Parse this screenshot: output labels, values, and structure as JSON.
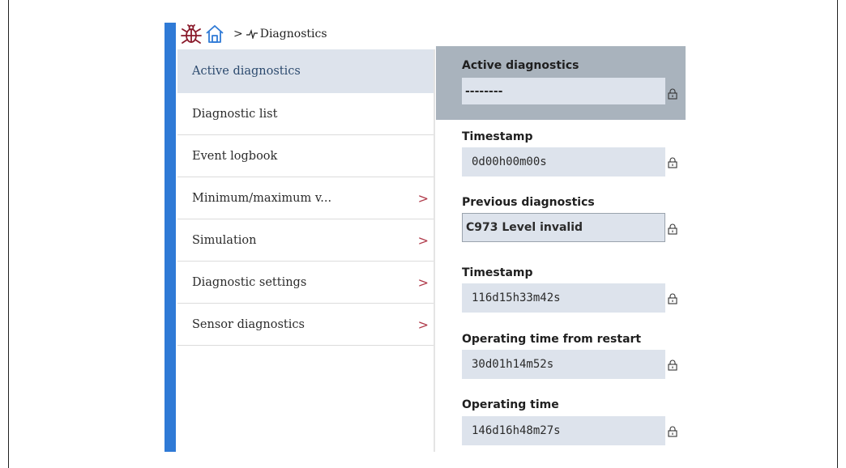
{
  "breadcrumb": {
    "separator": ">",
    "current": "Diagnostics"
  },
  "menu": {
    "items": [
      {
        "label": "Active diagnostics",
        "active": true,
        "has_submenu": false
      },
      {
        "label": "Diagnostic list",
        "active": false,
        "has_submenu": false
      },
      {
        "label": "Event logbook",
        "active": false,
        "has_submenu": false
      },
      {
        "label": "Minimum/maximum v...",
        "active": false,
        "has_submenu": true
      },
      {
        "label": "Simulation",
        "active": false,
        "has_submenu": true
      },
      {
        "label": "Diagnostic settings",
        "active": false,
        "has_submenu": true
      },
      {
        "label": "Sensor diagnostics",
        "active": false,
        "has_submenu": true
      }
    ],
    "chevron": ">"
  },
  "panel": {
    "fields": [
      {
        "label": "Active diagnostics",
        "value": "--------"
      },
      {
        "label": "Timestamp",
        "value": "0d00h00m00s"
      },
      {
        "label": "Previous diagnostics",
        "value": "C973 Level invalid"
      },
      {
        "label": "Timestamp",
        "value": "116d15h33m42s"
      },
      {
        "label": "Operating time from restart",
        "value": "30d01h14m52s"
      },
      {
        "label": "Operating time",
        "value": "146d16h48m27s"
      }
    ]
  },
  "colors": {
    "accent_blue": "#2f7ad6",
    "active_bg": "#dde3ec",
    "header_bg": "#a9b3bd",
    "bug_icon": "#8a1a2b",
    "home_icon": "#2f7ad6"
  }
}
